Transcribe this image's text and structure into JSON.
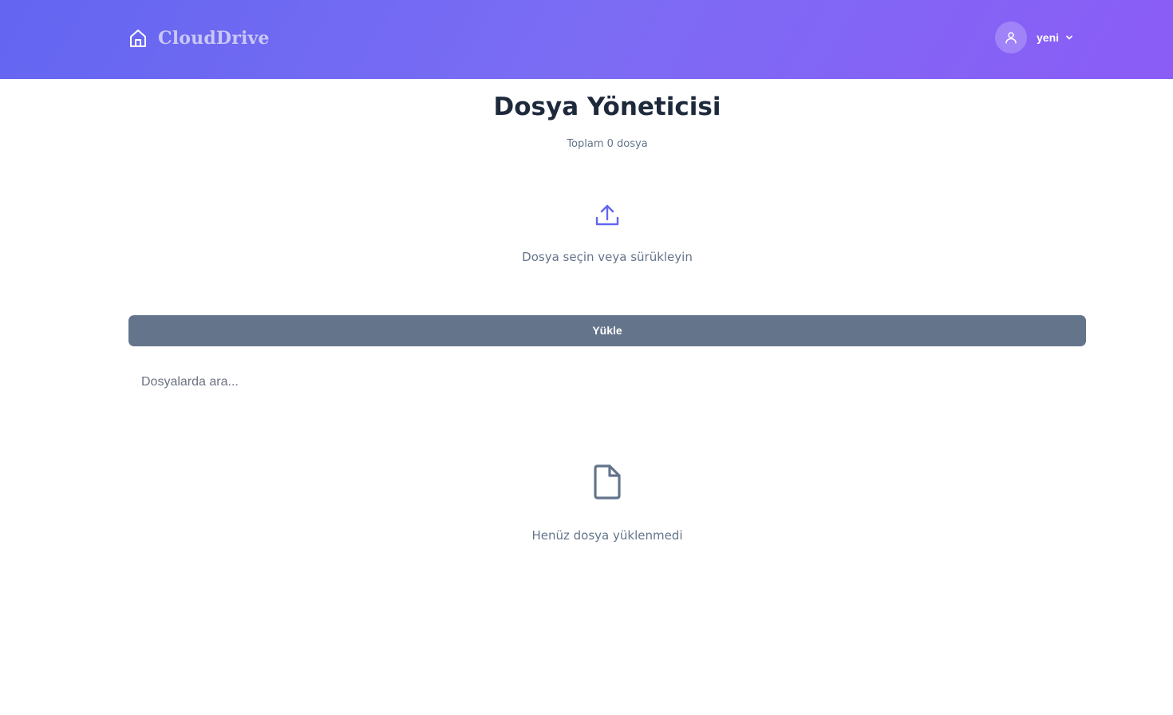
{
  "header": {
    "brand": "CloudDrive",
    "brand_icon": "home-icon",
    "user": {
      "name": "yeni",
      "avatar_icon": "user-icon",
      "menu_icon": "chevron-down-icon"
    }
  },
  "main": {
    "title": "Dosya Yöneticisi",
    "subtitle": "Toplam 0 dosya",
    "dropzone": {
      "icon": "upload-icon",
      "text": "Dosya seçin veya sürükleyin"
    },
    "upload_button": "Yükle",
    "search": {
      "placeholder": "Dosyalarda ara...",
      "value": ""
    },
    "empty_state": {
      "icon": "file-icon",
      "text": "Henüz dosya yüklenmedi"
    }
  },
  "colors": {
    "header_gradient_start": "#6366f1",
    "header_gradient_end": "#8b5cf6",
    "accent": "#6366f1",
    "button": "#64748b",
    "title": "#1e293b",
    "muted_text": "#64748b"
  }
}
